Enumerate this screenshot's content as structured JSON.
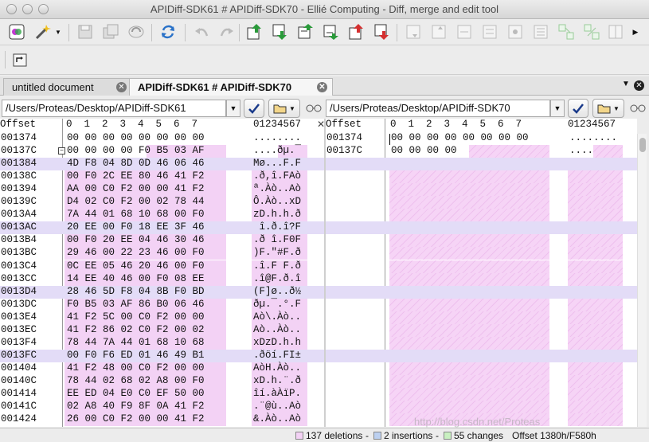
{
  "window": {
    "title": "APIDiff-SDK61 # APIDiff-SDK70 - Ellié Computing - Diff, merge and edit tool"
  },
  "toolbar": {
    "icons": [
      "compare-icon",
      "magic-wand-icon",
      "save-icon",
      "save-all-icon",
      "reload-icon",
      "refresh-icon",
      "undo-icon",
      "redo-icon",
      "first-diff-icon",
      "next-diff-icon",
      "prev-diff-icon",
      "last-diff-icon",
      "prev-conflict-icon",
      "next-conflict-icon",
      "copy-left-icon",
      "copy-right-icon",
      "merge-left-icon",
      "merge-right-icon",
      "options-icon",
      "swap-icon",
      "split-icon"
    ]
  },
  "tabs": [
    {
      "label": "untitled document"
    },
    {
      "label": "APIDiff-SDK61 # APIDiff-SDK70"
    }
  ],
  "left": {
    "path": "/Users/Proteas/Desktop/APIDiff-SDK61",
    "header_offset": "Offset",
    "header_cols": "0  1  2  3  4  5  6  7",
    "header_ascii": "01234567",
    "rows": [
      {
        "offset": "001374",
        "hex": "00 00 00 00 00 00 00 00",
        "ascii": "........",
        "style": "plain"
      },
      {
        "offset": "00137C",
        "hex": "00 00 00 00 F0 B5 03 AF",
        "ascii": "....ðµ.¯",
        "style": "pink-partial"
      },
      {
        "offset": "001384",
        "hex": "4D F8 04 8D 0D 46 06 46",
        "ascii": "Mø...F.F",
        "style": "lav"
      },
      {
        "offset": "00138C",
        "hex": "00 F0 2C EE 80 46 41 F2",
        "ascii": ".ð,î.FAò",
        "style": "pink"
      },
      {
        "offset": "001394",
        "hex": "AA 00 C0 F2 00 00 41 F2",
        "ascii": "ª.Àò..Aò",
        "style": "pink"
      },
      {
        "offset": "00139C",
        "hex": "D4 02 C0 F2 00 02 78 44",
        "ascii": "Ô.Àò..xD",
        "style": "pink"
      },
      {
        "offset": "0013A4",
        "hex": "7A 44 01 68 10 68 00 F0",
        "ascii": "zD.h.h.ð",
        "style": "pink"
      },
      {
        "offset": "0013AC",
        "hex": "20 EE 00 F0 18 EE 3F 46",
        "ascii": " î.ð.î?F",
        "style": "lav"
      },
      {
        "offset": "0013B4",
        "hex": "00 F0 20 EE 04 46 30 46",
        "ascii": ".ð î.F0F",
        "style": "pink"
      },
      {
        "offset": "0013BC",
        "hex": "29 46 00 22 23 46 00 F0",
        "ascii": ")F.\"#F.ð",
        "style": "pink"
      },
      {
        "offset": "0013C4",
        "hex": "0C EE 05 46 20 46 00 F0",
        "ascii": ".î.F F.ð",
        "style": "pink"
      },
      {
        "offset": "0013CC",
        "hex": "14 EE 40 46 00 F0 08 EE",
        "ascii": ".î@F.ð.î",
        "style": "pink"
      },
      {
        "offset": "0013D4",
        "hex": "28 46 5D F8 04 8B F0 BD",
        "ascii": "(F]ø..ð½",
        "style": "lav"
      },
      {
        "offset": "0013DC",
        "hex": "F0 B5 03 AF 86 B0 06 46",
        "ascii": "ðµ.¯.°.F",
        "style": "pink"
      },
      {
        "offset": "0013E4",
        "hex": "41 F2 5C 00 C0 F2 00 00",
        "ascii": "Aò\\.Àò..",
        "style": "pink"
      },
      {
        "offset": "0013EC",
        "hex": "41 F2 86 02 C0 F2 00 02",
        "ascii": "Aò..Àò..",
        "style": "pink"
      },
      {
        "offset": "0013F4",
        "hex": "78 44 7A 44 01 68 10 68",
        "ascii": "xDzD.h.h",
        "style": "pink"
      },
      {
        "offset": "0013FC",
        "hex": "00 F0 F6 ED 01 46 49 B1",
        "ascii": ".ðöí.FI±",
        "style": "lav"
      },
      {
        "offset": "001404",
        "hex": "41 F2 48 00 C0 F2 00 00",
        "ascii": "AòH.Àò..",
        "style": "pink"
      },
      {
        "offset": "00140C",
        "hex": "78 44 02 68 02 A8 00 F0",
        "ascii": "xD.h.¨.ð",
        "style": "pink"
      },
      {
        "offset": "001414",
        "hex": "EE ED 04 E0 C0 EF 50 00",
        "ascii": "îí.àÀïP.",
        "style": "pink"
      },
      {
        "offset": "00141C",
        "hex": "02 A8 40 F9 8F 0A 41 F2",
        "ascii": ".¨@ù..Aò",
        "style": "pink"
      },
      {
        "offset": "001424",
        "hex": "26 00 C0 F2 00 00 41 F2",
        "ascii": "&.Àò..Aò",
        "style": "pink"
      }
    ]
  },
  "right": {
    "path": "/Users/Proteas/Desktop/APIDiff-SDK70",
    "header_offset": "Offset",
    "header_cols": "0  1  2  3  4  5  6  7",
    "header_ascii": "01234567",
    "rows": [
      {
        "offset": "001374",
        "hex": "00 00 00 00 00 00 00 00",
        "ascii": "........"
      },
      {
        "offset": "00137C",
        "hex": "00 00 00 00",
        "ascii": "...."
      }
    ]
  },
  "status": {
    "deletions": "137 deletions",
    "insertions": "2 insertions",
    "changes": "55 changes",
    "offset": "Offset 1380h/F580h",
    "sep": "-"
  },
  "colors": {
    "deletion": "#f3d2f5",
    "insertion": "#bcd0f0",
    "change": "#c8f0c0",
    "modified_row": "#e3dcf7"
  },
  "watermark": "http://blog.csdn.net/Proteas"
}
